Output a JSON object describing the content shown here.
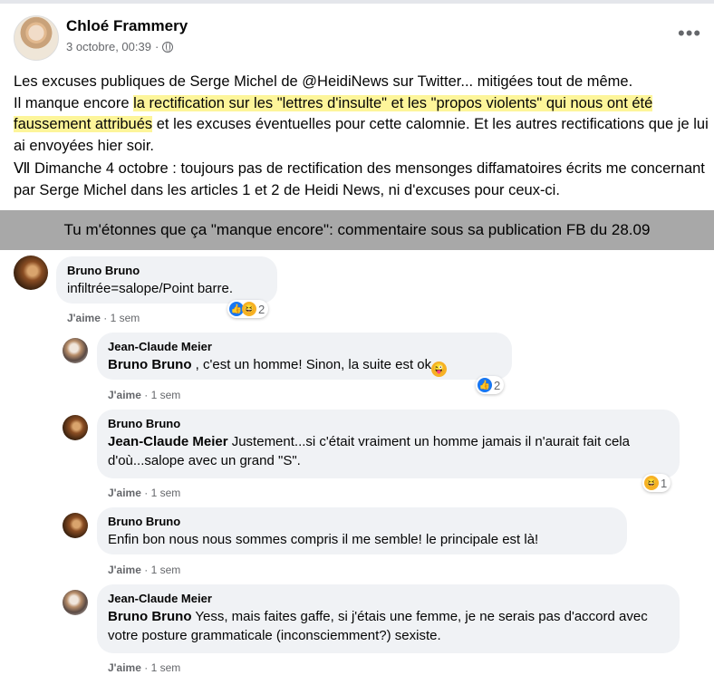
{
  "post": {
    "author": "Chloé Frammery",
    "date": "3 octobre, 00:39",
    "separator": "·",
    "more_label": "•••",
    "paragraph1_a": "Les excuses publiques de Serge Michel de @HeidiNews sur Twitter... mitigées tout de même.",
    "paragraph1_b": "Il manque encore ",
    "paragraph1_hl": "la rectification sur les \"lettres d'insulte\" et les \"propos violents\" qui nous ont été faussement attribués",
    "paragraph1_c": " et les excuses éventuelles pour cette calomnie. Et les autres rectifications que je lui ai envoyées hier soir.",
    "paragraph2": "Ⅶ Dimanche 4 octobre : toujours pas de rectification des mensonges diffamatoires écrits me concernant par Serge Michel dans les articles 1 et 2 de Heidi News, ni d'excuses pour ceux-ci."
  },
  "banner": "Tu m'étonnes que ça \"manque encore\": commentaire sous sa publication FB du 28.09",
  "comments": [
    {
      "name": "Bruno Bruno",
      "mention": "",
      "text": "infiltrée=salope/Point barre.",
      "like": "J'aime",
      "time": "1 sem",
      "reaction_count": "2"
    },
    {
      "name": "Jean-Claude Meier",
      "mention": "Bruno Bruno",
      "text": " , c'est un homme! Sinon, la suite est ok",
      "like": "J'aime",
      "time": "1 sem",
      "reaction_count": "2"
    },
    {
      "name": "Bruno Bruno",
      "mention": "Jean-Claude Meier",
      "text": " Justement...si c'était vraiment un homme jamais il n'aurait fait cela d'où...salope avec un grand \"S\".",
      "like": "J'aime",
      "time": "1 sem",
      "reaction_count": "1"
    },
    {
      "name": "Bruno Bruno",
      "mention": "",
      "text": "Enfin bon nous nous sommes compris il me semble! le principale est là!",
      "like": "J'aime",
      "time": "1 sem",
      "reaction_count": ""
    },
    {
      "name": "Jean-Claude Meier",
      "mention": "Bruno Bruno",
      "text": " Yess, mais faites gaffe, si j'étais une femme, je ne serais pas d'accord avec votre posture grammaticale (inconsciemment?) sexiste.",
      "like": "J'aime",
      "time": "1 sem",
      "reaction_count": ""
    }
  ],
  "dot": "·",
  "icons": {
    "globe": "globe-icon",
    "like_reaction": "like-reaction-icon",
    "haha_reaction": "haha-reaction-icon",
    "wink_emoji": "wink-emoji-icon"
  },
  "colors": {
    "highlight": "#fdf59a",
    "banner": "#a8a8a8",
    "bubble": "#f0f2f5",
    "like_blue": "#1877f2"
  }
}
